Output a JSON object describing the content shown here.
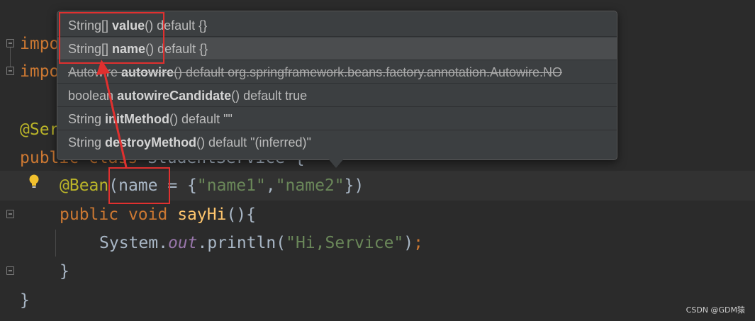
{
  "editor": {
    "lines": {
      "import1_kw": "impo",
      "import2_kw": "impo",
      "service_annotation": "@Ser",
      "class_public": "public",
      "class_class": "class",
      "class_name": "StudentService",
      "class_brace": "{",
      "bean_annotation": "@Bean",
      "bean_paren_open": "(",
      "bean_param": "name",
      "bean_eq": " = {",
      "bean_str1": "\"name1\"",
      "bean_comma": ",",
      "bean_str2": "\"name2\"",
      "bean_close": "})",
      "method_public": "public",
      "method_void": "void",
      "method_name": "sayHi",
      "method_rest": "(){",
      "println_system": "System.",
      "println_out": "out",
      "println_call": ".println(",
      "println_str": "\"Hi,Service\"",
      "println_close": ")",
      "println_semi": ";",
      "method_close": "}",
      "class_close": "}"
    },
    "colors": {
      "background": "#2b2b2b",
      "keyword": "#cc7832",
      "annotation": "#bbb529",
      "string": "#6a8759",
      "field": "#9876aa",
      "method": "#ffc66d",
      "highlight": "#e0302f"
    },
    "gutter_icons": [
      "fold-icon",
      "lightbulb-icon"
    ]
  },
  "popup": {
    "rows": [
      {
        "type": "String[]",
        "name": "value",
        "suffix": "() default {}"
      },
      {
        "type": "String[]",
        "name": "name",
        "suffix": "() default {}"
      },
      {
        "type": "Autowire",
        "name": "autowire",
        "suffix": "() default org.springframework.beans.factory.annotation.Autowire.NO"
      },
      {
        "type": "boolean",
        "name": "autowireCandidate",
        "suffix": "() default true"
      },
      {
        "type": "String",
        "name": "initMethod",
        "suffix": "() default \"\""
      },
      {
        "type": "String",
        "name": "destroyMethod",
        "suffix": "() default \"(inferred)\""
      }
    ]
  },
  "watermark": "CSDN @GDM猿"
}
